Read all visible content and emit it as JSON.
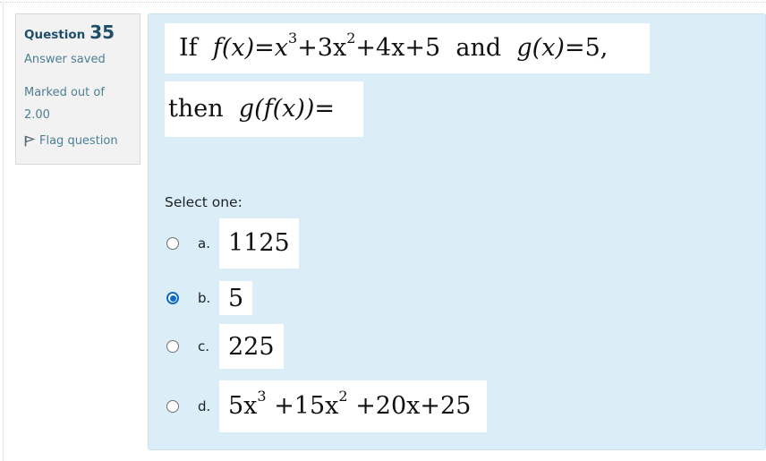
{
  "info": {
    "question_label": "Question",
    "question_number": "35",
    "state": "Answer saved",
    "grade_line1": "Marked out of",
    "grade_line2": "2.00",
    "flag_label": "Flag question"
  },
  "question": {
    "line1": {
      "if": "If",
      "f_x": "f(x)",
      "eq": "=",
      "x": "x",
      "exp3": "3",
      "t2": "+3x",
      "exp2": "2",
      "rest": "+4x+5",
      "and": "and",
      "g_x": "g(x)",
      "eq2": "=5,"
    },
    "line2": {
      "then": "then",
      "expr": "g(f(x))",
      "eq": "="
    },
    "prompt": "Select one:"
  },
  "options": [
    {
      "letter": "a.",
      "value": "1125",
      "selected": false
    },
    {
      "letter": "b.",
      "value": "5",
      "selected": true
    },
    {
      "letter": "c.",
      "value": "225",
      "selected": false
    },
    {
      "letter": "d.",
      "value": "5x³ +15x² +20x+25",
      "selected": false
    }
  ],
  "option_d_parts": {
    "a": "5x",
    "e1": "3",
    "b": "+15x",
    "e2": "2",
    "c": "+20x+25"
  },
  "colors": {
    "accent": "#0f6cbf",
    "panel": "#dbedf6",
    "info_bg": "#f2f2f2",
    "link": "#4d7f95"
  }
}
